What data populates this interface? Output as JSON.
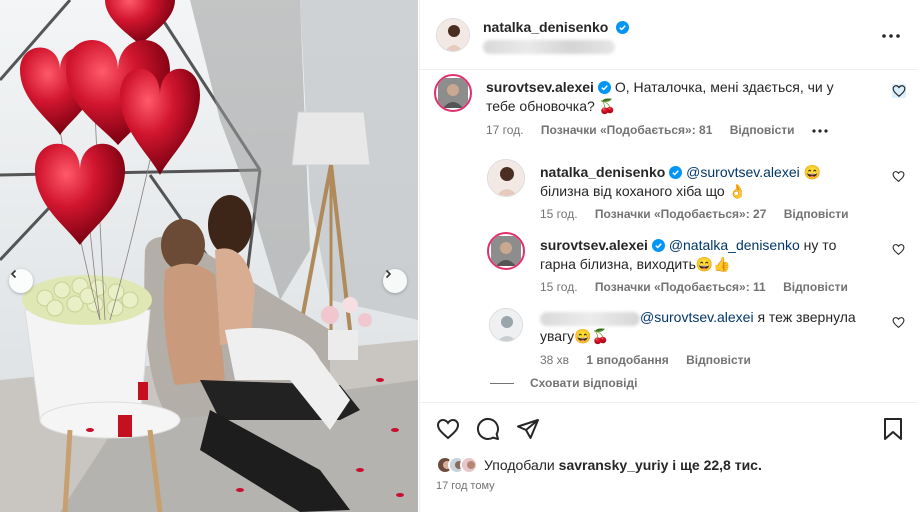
{
  "post": {
    "author": "natalka_denisenko",
    "author_verified": true,
    "time_ago": "17 год тому"
  },
  "comments": [
    {
      "user": "surovtsev.alexei",
      "verified": true,
      "text_parts": [
        "О, Наталочка, мені здається, чи у тебе обновочка? 🍒"
      ],
      "time": "17 год.",
      "likes": "Позначки «Подобається»: 81",
      "reply": "Відповісти"
    },
    {
      "user": "natalka_denisenko",
      "verified": true,
      "mention": "@surovtsev.alexei",
      "text": " 😄 білизна від коханого хіба що 👌",
      "time": "15 год.",
      "likes": "Позначки «Подобається»: 27",
      "reply": "Відповісти"
    },
    {
      "user": "surovtsev.alexei",
      "verified": true,
      "mention": "@natalka_denisenko",
      "text": " ну то гарна білизна, виходить😄👍",
      "time": "15 год.",
      "likes": "Позначки «Подобається»: 11",
      "reply": "Відповісти"
    },
    {
      "user": "",
      "verified": false,
      "mention": "@surovtsev.alexei",
      "text": " я теж звернула увагу😄🍒",
      "time": "38 хв",
      "likes": "1 вподобання",
      "reply": "Відповісти"
    }
  ],
  "hide_replies": "Сховати відповіді",
  "likes": {
    "prefix": "Уподобали ",
    "user": "savransky_yuriy",
    "suffix": " і ще 22,8 тис."
  },
  "icons": {
    "like": "heart-icon",
    "comment": "comment-icon",
    "share": "send-icon",
    "save": "bookmark-icon",
    "more": "more-icon",
    "verified": "verified-badge-icon",
    "prev": "chevron-left-icon",
    "next": "chevron-right-icon"
  },
  "colors": {
    "verified": "#0095f6",
    "mention": "#00376b",
    "secondary": "#737373",
    "balloon": "#c8102e"
  }
}
